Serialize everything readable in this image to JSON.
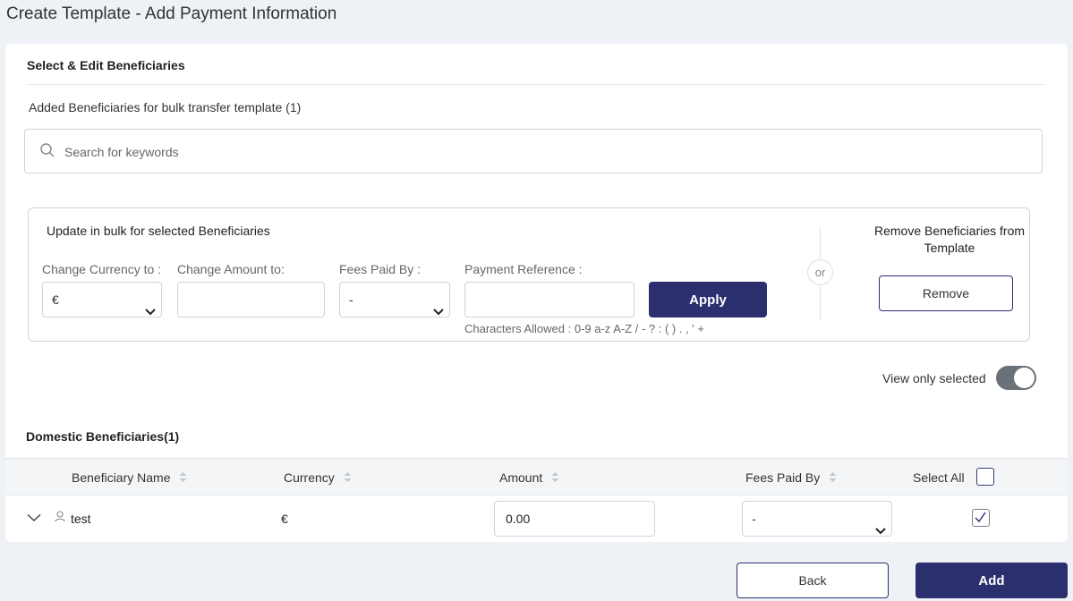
{
  "page_title": "Create Template - Add Payment Information",
  "section_title": "Select & Edit Beneficiaries",
  "added_label": "Added Beneficiaries for bulk transfer template  (1)",
  "search": {
    "placeholder": "Search for keywords"
  },
  "bulk_update": {
    "title": "Update in bulk for selected Beneficiaries",
    "currency_label": "Change Currency to :",
    "currency_value": "€",
    "amount_label": "Change Amount to:",
    "fees_label": "Fees Paid By :",
    "fees_value": "-",
    "reference_label": "Payment Reference :",
    "apply_label": "Apply",
    "chars_hint": "Characters Allowed : 0-9 a-z A-Z / - ? : ( ) . , ' +",
    "or_label": "or",
    "remove_title": "Remove Beneficiaries from Template",
    "remove_label": "Remove"
  },
  "view_toggle": {
    "label": "View only selected",
    "on": true
  },
  "domestic_title": "Domestic Beneficiaries(1)",
  "table": {
    "headers": {
      "name": "Beneficiary Name",
      "currency": "Currency",
      "amount": "Amount",
      "fees": "Fees Paid By",
      "select_all": "Select All"
    },
    "rows": [
      {
        "name": "test",
        "currency": "€",
        "amount": "0.00",
        "fees": "-",
        "selected": true
      }
    ]
  },
  "footer": {
    "back_label": "Back",
    "add_label": "Add"
  },
  "colors": {
    "primary": "#2b2f6e",
    "background": "#eef1f6",
    "toggle": "#6b7178"
  }
}
